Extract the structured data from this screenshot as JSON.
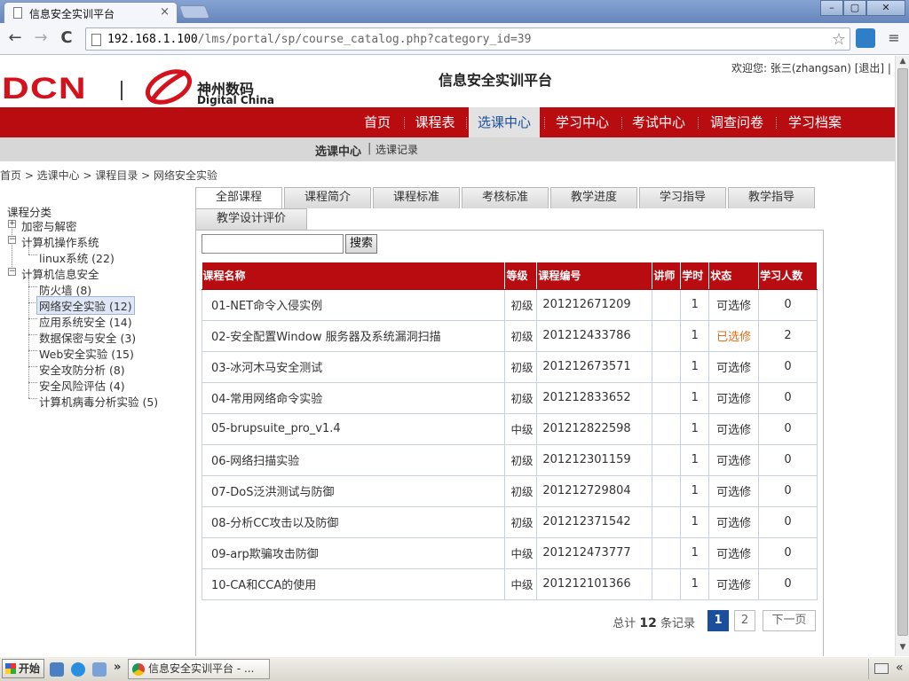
{
  "browser": {
    "tab_title": "信息安全实训平台",
    "tab_close": "×",
    "url_host": "192.168.1.100",
    "url_rest": "/lms/portal/sp/course_catalog.php?category_id=39",
    "back": "←",
    "forward": "→",
    "reload": "C",
    "star": "☆",
    "menu": "≡",
    "min": "–",
    "max": "▢",
    "close": "✕"
  },
  "header": {
    "logo_dcn": "DCN",
    "logo_cn": "神州数码",
    "logo_en": "Digital China",
    "site_title": "信息安全实训平台",
    "welcome": "欢迎您: 张三(zhangsan) [退出] |"
  },
  "nav": {
    "items": [
      "首页",
      "课程表",
      "选课中心",
      "学习中心",
      "考试中心",
      "调查问卷",
      "学习档案"
    ],
    "active_index": 2
  },
  "subnav": {
    "current": "选课中心",
    "separator": "|",
    "other": "选课记录"
  },
  "breadcrumb": "首页 > 选课中心 > 课程目录 > 网络安全实验",
  "tree": {
    "root": "课程分类",
    "nodes": [
      {
        "label": "加密与解密",
        "box": "+"
      },
      {
        "label": "计算机操作系统",
        "box": "−"
      },
      {
        "label": "linux系统 (22)"
      },
      {
        "label": "计算机信息安全",
        "box": "−"
      },
      {
        "label": "防火墙 (8)"
      },
      {
        "label": "网络安全实验 (12)"
      },
      {
        "label": "应用系统安全 (14)"
      },
      {
        "label": "数据保密与安全 (3)"
      },
      {
        "label": "Web安全实验 (15)"
      },
      {
        "label": "安全攻防分析 (8)"
      },
      {
        "label": "安全风险评估 (4)"
      },
      {
        "label": "计算机病毒分析实验 (5)"
      }
    ]
  },
  "tabs": [
    "全部课程",
    "课程简介",
    "课程标准",
    "考核标准",
    "教学进度",
    "学习指导",
    "教学指导",
    "教学设计评价"
  ],
  "search": {
    "button": "搜索",
    "value": ""
  },
  "table": {
    "headers": [
      "课程名称",
      "等级",
      "课程编号",
      "讲师",
      "学时",
      "状态",
      "学习人数"
    ],
    "rows": [
      {
        "name": "01-NET命令入侵实例",
        "level": "初级",
        "code": "201212671209",
        "teacher": "",
        "hours": "1",
        "status": "可选修",
        "learners": "0"
      },
      {
        "name": "02-安全配置Window 服务器及系统漏洞扫描",
        "level": "初级",
        "code": "201212433786",
        "teacher": "",
        "hours": "1",
        "status": "已选修",
        "learners": "2"
      },
      {
        "name": "03-冰河木马安全测试",
        "level": "初级",
        "code": "201212673571",
        "teacher": "",
        "hours": "1",
        "status": "可选修",
        "learners": "0"
      },
      {
        "name": "04-常用网络命令实验",
        "level": "初级",
        "code": "201212833652",
        "teacher": "",
        "hours": "1",
        "status": "可选修",
        "learners": "0"
      },
      {
        "name": "05-brupsuite_pro_v1.4",
        "level": "中级",
        "code": "201212822598",
        "teacher": "",
        "hours": "1",
        "status": "可选修",
        "learners": "0"
      },
      {
        "name": "06-网络扫描实验",
        "level": "初级",
        "code": "201212301159",
        "teacher": "",
        "hours": "1",
        "status": "可选修",
        "learners": "0"
      },
      {
        "name": "07-DoS泛洪测试与防御",
        "level": "初级",
        "code": "201212729804",
        "teacher": "",
        "hours": "1",
        "status": "可选修",
        "learners": "0"
      },
      {
        "name": "08-分析CC攻击以及防御",
        "level": "初级",
        "code": "201212371542",
        "teacher": "",
        "hours": "1",
        "status": "可选修",
        "learners": "0"
      },
      {
        "name": "09-arp欺骗攻击防御",
        "level": "中级",
        "code": "201212473777",
        "teacher": "",
        "hours": "1",
        "status": "可选修",
        "learners": "0"
      },
      {
        "name": "10-CA和CCA的使用",
        "level": "中级",
        "code": "201212101366",
        "teacher": "",
        "hours": "1",
        "status": "可选修",
        "learners": "0"
      }
    ]
  },
  "pager": {
    "prefix": "总计",
    "total": "12",
    "suffix": "条记录",
    "page1": "1",
    "page2": "2",
    "next": "下一页"
  },
  "taskbar": {
    "start": "开始",
    "chevron": "»",
    "item": "信息安全实训平台 - ...",
    "tray_arrow": "«"
  },
  "colors": {
    "brand_red": "#b90c11",
    "active_blue": "#1b4f9e",
    "selected_orange": "#e36d1a"
  }
}
